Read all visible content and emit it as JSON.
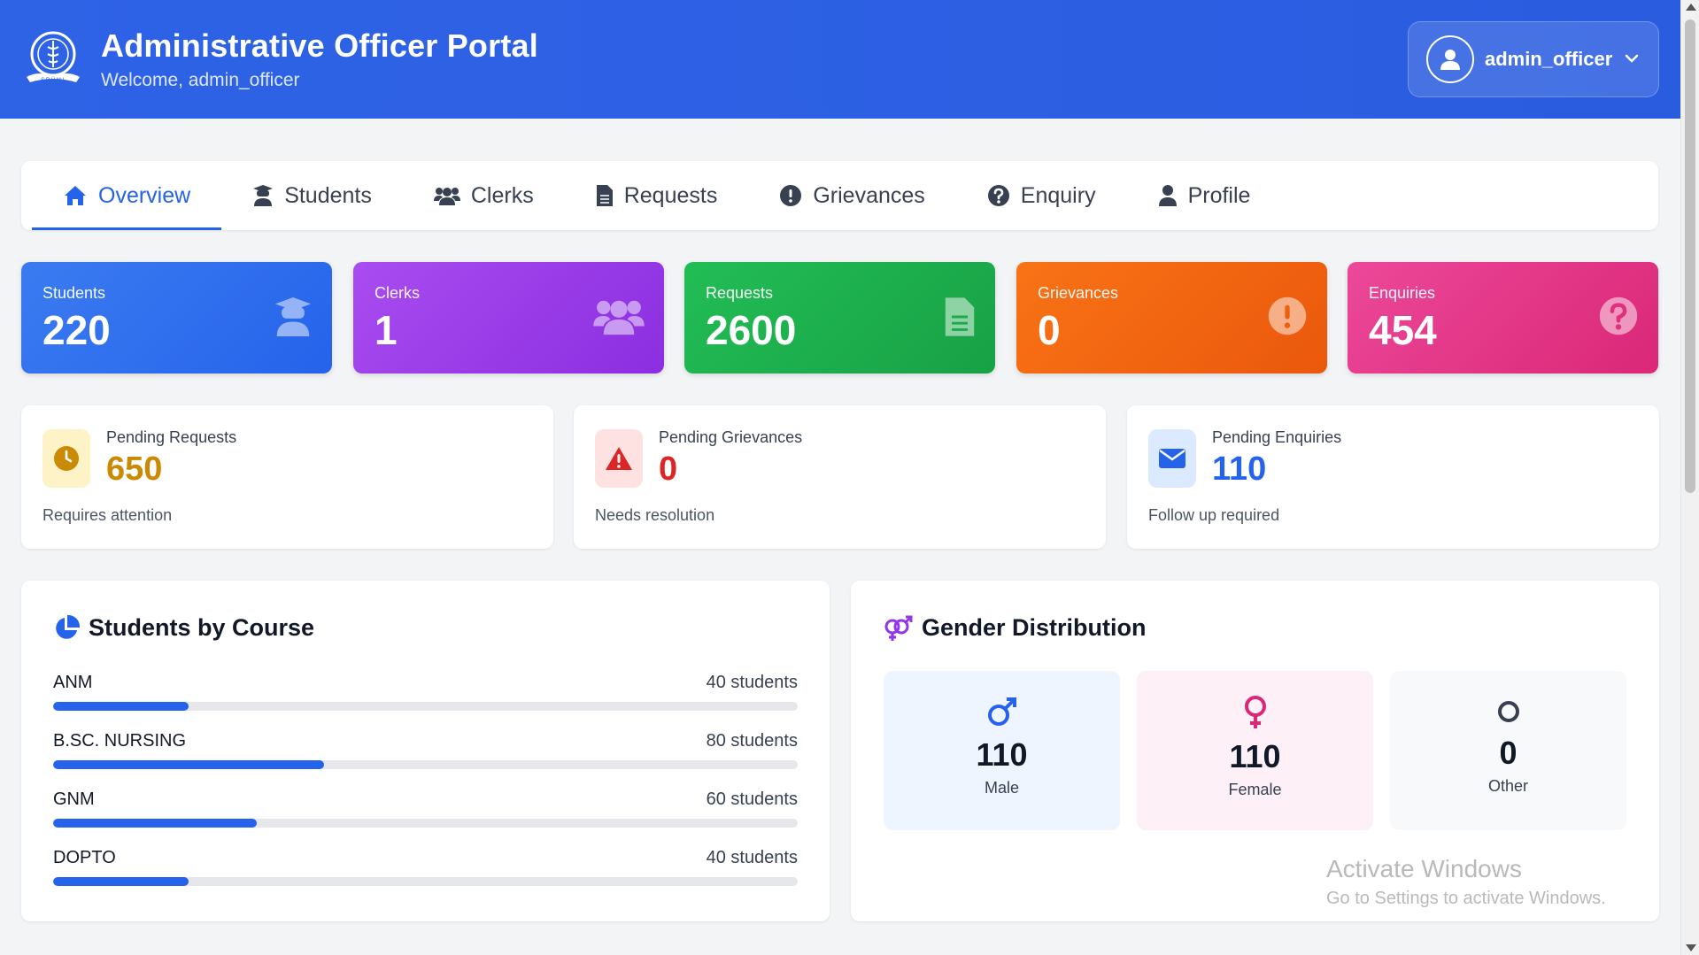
{
  "header": {
    "title": "Administrative Officer Portal",
    "welcome": "Welcome, admin_officer",
    "user": "admin_officer",
    "logo_text": "S.R.H.M.I."
  },
  "tabs": [
    {
      "label": "Overview",
      "icon": "home-icon",
      "active": true
    },
    {
      "label": "Students",
      "icon": "graduate-icon",
      "active": false
    },
    {
      "label": "Clerks",
      "icon": "users-icon",
      "active": false
    },
    {
      "label": "Requests",
      "icon": "file-icon",
      "active": false
    },
    {
      "label": "Grievances",
      "icon": "exclamation-circle-icon",
      "active": false
    },
    {
      "label": "Enquiry",
      "icon": "question-circle-icon",
      "active": false
    },
    {
      "label": "Profile",
      "icon": "user-icon",
      "active": false
    }
  ],
  "stats": [
    {
      "label": "Students",
      "value": "220",
      "color": "#2f6fe6"
    },
    {
      "label": "Clerks",
      "value": "1",
      "color": "#9b3ae6"
    },
    {
      "label": "Requests",
      "value": "2600",
      "color": "#1fae4e"
    },
    {
      "label": "Grievances",
      "value": "0",
      "color": "#f0630f"
    },
    {
      "label": "Enquiries",
      "value": "454",
      "color": "#e2317f"
    }
  ],
  "pending": [
    {
      "label": "Pending Requests",
      "value": "650",
      "note": "Requires attention",
      "value_color": "#ca8a04",
      "icon_bg": "#fef3c7"
    },
    {
      "label": "Pending Grievances",
      "value": "0",
      "note": "Needs resolution",
      "value_color": "#dc2626",
      "icon_bg": "#fee2e2"
    },
    {
      "label": "Pending Enquiries",
      "value": "110",
      "note": "Follow up required",
      "value_color": "#2563eb",
      "icon_bg": "#dbeafe"
    }
  ],
  "courses": {
    "title": "Students by Course",
    "items": [
      {
        "name": "ANM",
        "count": "40 students",
        "fraction": 0.182
      },
      {
        "name": "B.SC. NURSING",
        "count": "80 students",
        "fraction": 0.364
      },
      {
        "name": "GNM",
        "count": "60 students",
        "fraction": 0.273
      },
      {
        "name": "DOPTO",
        "count": "40 students",
        "fraction": 0.182
      }
    ]
  },
  "gender": {
    "title": "Gender Distribution",
    "items": [
      {
        "label": "Male",
        "value": "110",
        "bg": "#eff5ff"
      },
      {
        "label": "Female",
        "value": "110",
        "bg": "#fdf0f6"
      },
      {
        "label": "Other",
        "value": "0",
        "bg": "#f8f9fb"
      }
    ]
  },
  "watermark": {
    "line1": "Activate Windows",
    "line2": "Go to Settings to activate Windows."
  }
}
